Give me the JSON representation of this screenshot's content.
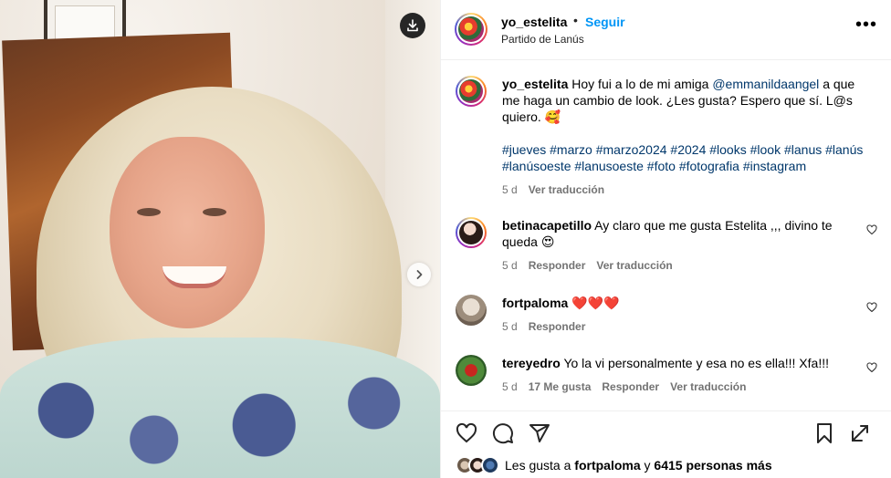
{
  "post": {
    "username": "yo_estelita",
    "separator": "•",
    "follow_label": "Seguir",
    "location": "Partido de Lanús",
    "more_label": "•••"
  },
  "caption": {
    "username": "yo_estelita",
    "text_before": "Hoy fui a lo de mi amiga",
    "mention": "@emmanildaangel",
    "text_after": "a que me haga un cambio de look. ¿Les gusta? Espero que sí. L@s quiero. 🥰",
    "hashtags": "#jueves #marzo #marzo2024 #2024 #looks #look #lanus #lanús #lanúsoeste #lanusoeste #foto #fotografia #instagram",
    "time": "5 d",
    "translate_label": "Ver traducción"
  },
  "comments": [
    {
      "username": "betinacapetillo",
      "text": "Ay claro que me gusta Estelita ,,, divino te queda 😍",
      "time": "5 d",
      "likes": "",
      "reply_label": "Responder",
      "translate_label": "Ver traducción"
    },
    {
      "username": "fortpaloma",
      "text": "❤️❤️❤️",
      "time": "5 d",
      "likes": "",
      "reply_label": "Responder",
      "translate_label": ""
    },
    {
      "username": "tereyedro",
      "text": "Yo la vi personalmente y esa no es ella!!! Xfa!!!",
      "time": "5 d",
      "likes": "17 Me gusta",
      "reply_label": "Responder",
      "translate_label": "Ver traducción"
    }
  ],
  "likes_line": {
    "prefix": "Les gusta a",
    "user": "fortpaloma",
    "middle": "y",
    "count": "6415 personas más"
  },
  "icons": {
    "download": "download-icon",
    "next": "chevron-right-icon",
    "like": "heart-icon",
    "comment": "comment-icon",
    "share": "send-icon",
    "save": "bookmark-icon"
  },
  "colors": {
    "follow_blue": "#0095f6",
    "link_blue": "#00376b",
    "muted": "#737373"
  }
}
